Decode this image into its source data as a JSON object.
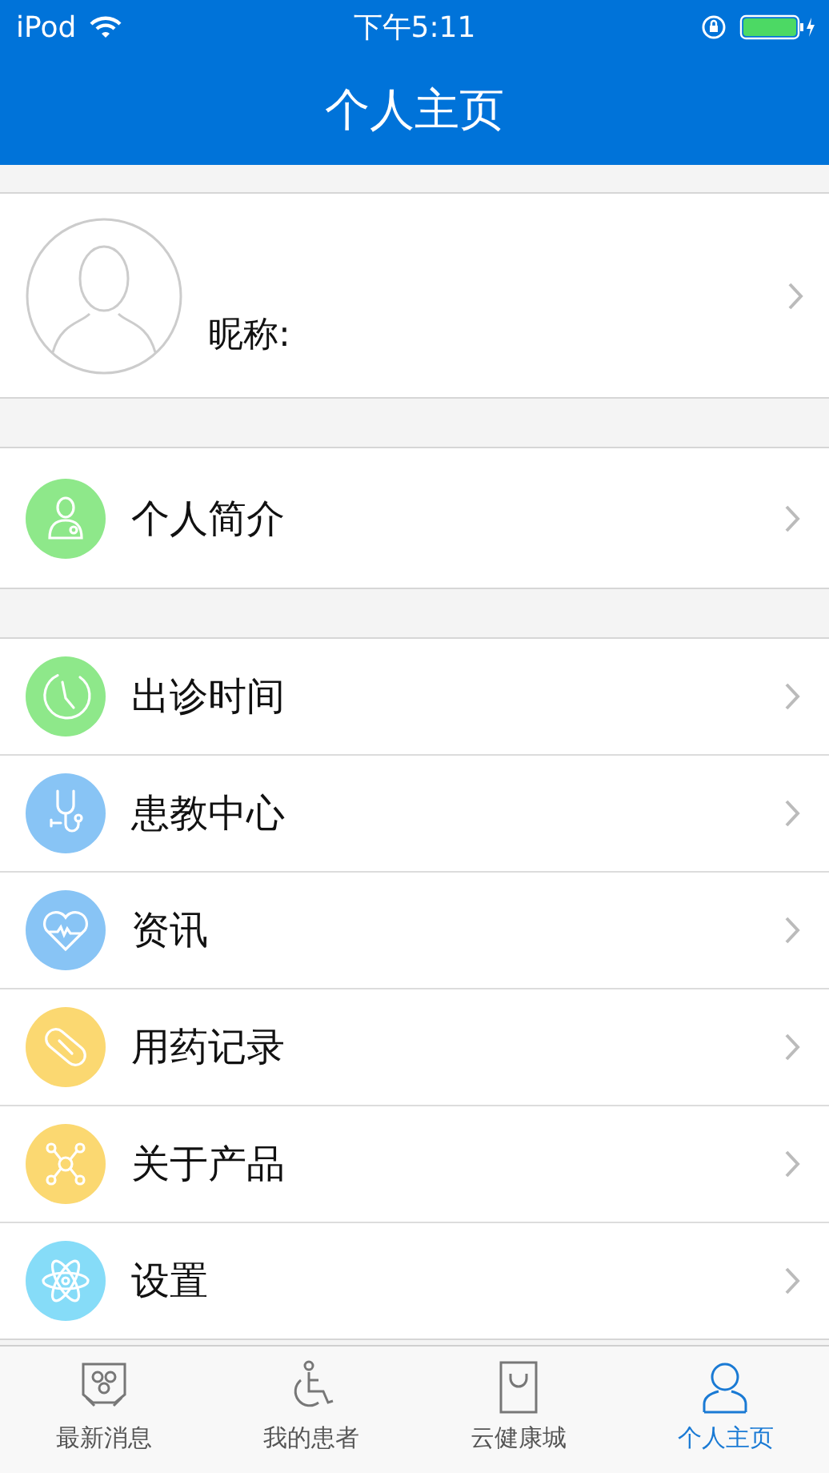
{
  "status_bar": {
    "carrier": "iPod",
    "time": "下午5:11"
  },
  "nav_bar": {
    "title": "个人主页"
  },
  "profile": {
    "nickname_label": "昵称:"
  },
  "sections": [
    {
      "items": [
        {
          "label": "个人简介",
          "color": "#8ee88a"
        }
      ]
    },
    {
      "items": [
        {
          "label": "出诊时间",
          "color": "#8ee88a"
        },
        {
          "label": "患教中心",
          "color": "#88c4f5"
        },
        {
          "label": "资讯",
          "color": "#88c4f5"
        },
        {
          "label": "用药记录",
          "color": "#fbd871"
        },
        {
          "label": "关于产品",
          "color": "#fbd871"
        },
        {
          "label": "设置",
          "color": "#86dcf8"
        }
      ]
    }
  ],
  "tab_bar": [
    {
      "label": "最新消息",
      "selected": false
    },
    {
      "label": "我的患者",
      "selected": false
    },
    {
      "label": "云健康城",
      "selected": false
    },
    {
      "label": "个人主页",
      "selected": true
    }
  ]
}
